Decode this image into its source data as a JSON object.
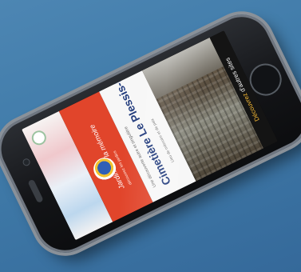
{
  "screen": {
    "red_title": "Jardins de la mémoire",
    "red_subtitle": "découvrez les jardins",
    "kicker": "Une découverte autre et singulière",
    "headline_line1": "Cimetière Le Plessis-Belleville",
    "desc": "Lieu de mémoire et de paix",
    "cta_accent": "Découvrez",
    "cta_rest": " d'autres sites"
  },
  "colors": {
    "background": "#3f7aa8",
    "red_panel": "#e1452b",
    "headline": "#203a7c",
    "accent": "#f2b634"
  }
}
